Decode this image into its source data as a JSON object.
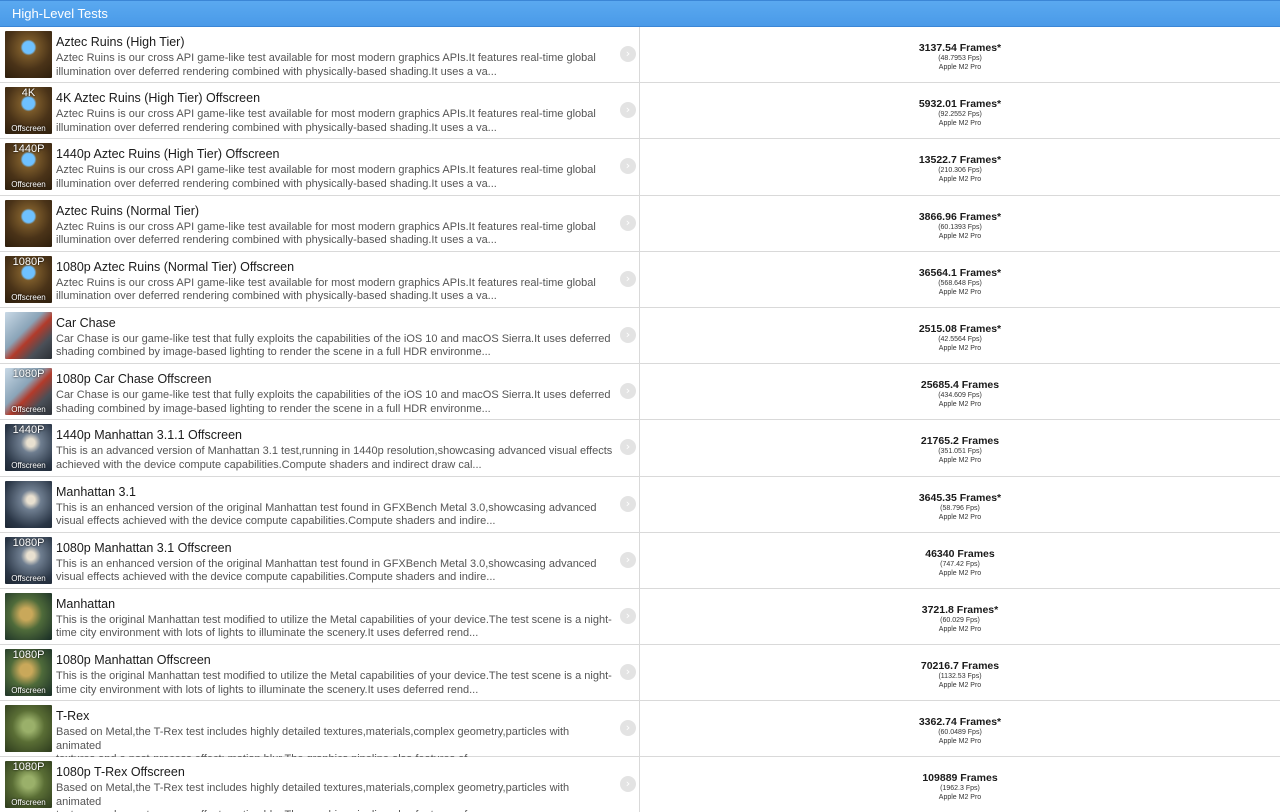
{
  "header": {
    "title": "High-Level Tests"
  },
  "tests": [
    {
      "thumb": "aztec",
      "thumb_top": "",
      "thumb_bottom": "",
      "title": "Aztec Ruins (High Tier)",
      "desc_line1": "Aztec Ruins is our cross API game-like test available for most modern graphics APIs.It features real-time global",
      "desc_line2": "illumination over deferred rendering combined with physically-based shading.It uses a va...",
      "score": "3137.54 Frames*",
      "fps": "(48.7953 Fps)",
      "device": "Apple M2 Pro"
    },
    {
      "thumb": "aztec",
      "thumb_top": "4K",
      "thumb_bottom": "Offscreen",
      "title": "4K Aztec Ruins (High Tier) Offscreen",
      "desc_line1": "Aztec Ruins is our cross API game-like test available for most modern graphics APIs.It features real-time global",
      "desc_line2": "illumination over deferred rendering combined with physically-based shading.It uses a va...",
      "score": "5932.01 Frames*",
      "fps": "(92.2552 Fps)",
      "device": "Apple M2 Pro"
    },
    {
      "thumb": "aztec",
      "thumb_top": "1440P",
      "thumb_bottom": "Offscreen",
      "title": "1440p Aztec Ruins (High Tier) Offscreen",
      "desc_line1": "Aztec Ruins is our cross API game-like test available for most modern graphics APIs.It features real-time global",
      "desc_line2": "illumination over deferred rendering combined with physically-based shading.It uses a va...",
      "score": "13522.7 Frames*",
      "fps": "(210.306 Fps)",
      "device": "Apple M2 Pro"
    },
    {
      "thumb": "aztec",
      "thumb_top": "",
      "thumb_bottom": "",
      "title": "Aztec Ruins (Normal Tier)",
      "desc_line1": "Aztec Ruins is our cross API game-like test available for most modern graphics APIs.It features real-time global",
      "desc_line2": "illumination over deferred rendering combined with physically-based shading.It uses a va...",
      "score": "3866.96 Frames*",
      "fps": "(60.1393 Fps)",
      "device": "Apple M2 Pro"
    },
    {
      "thumb": "aztec",
      "thumb_top": "1080P",
      "thumb_bottom": "Offscreen",
      "title": "1080p Aztec Ruins (Normal Tier) Offscreen",
      "desc_line1": "Aztec Ruins is our cross API game-like test available for most modern graphics APIs.It features real-time global",
      "desc_line2": "illumination over deferred rendering combined with physically-based shading.It uses a va...",
      "score": "36564.1 Frames*",
      "fps": "(568.648 Fps)",
      "device": "Apple M2 Pro"
    },
    {
      "thumb": "car",
      "thumb_top": "",
      "thumb_bottom": "",
      "title": "Car Chase",
      "desc_line1": "Car Chase is our game-like test that fully exploits the capabilities of the iOS 10 and macOS Sierra.It uses deferred",
      "desc_line2": "shading combined by image-based lighting to render the scene in a full HDR environme...",
      "score": "2515.08 Frames*",
      "fps": "(42.5564 Fps)",
      "device": "Apple M2 Pro"
    },
    {
      "thumb": "car",
      "thumb_top": "1080P",
      "thumb_bottom": "Offscreen",
      "title": "1080p Car Chase Offscreen",
      "desc_line1": "Car Chase is our game-like test that fully exploits the capabilities of the iOS 10 and macOS Sierra.It uses deferred",
      "desc_line2": "shading combined by image-based lighting to render the scene in a full HDR environme...",
      "score": "25685.4 Frames",
      "fps": "(434.609 Fps)",
      "device": "Apple M2 Pro"
    },
    {
      "thumb": "man",
      "thumb_top": "1440P",
      "thumb_bottom": "Offscreen",
      "title": "1440p Manhattan 3.1.1 Offscreen",
      "desc_line1": "This is an advanced version of Manhattan 3.1 test,running in 1440p resolution,showcasing advanced visual effects",
      "desc_line2": "achieved with the device compute capabilities.Compute shaders and indirect draw cal...",
      "score": "21765.2 Frames",
      "fps": "(351.051 Fps)",
      "device": "Apple M2 Pro"
    },
    {
      "thumb": "man",
      "thumb_top": "",
      "thumb_bottom": "",
      "title": "Manhattan 3.1",
      "desc_line1": "This is an enhanced version of the original Manhattan test found in GFXBench Metal 3.0,showcasing advanced",
      "desc_line2": "visual effects achieved with the device compute capabilities.Compute shaders and indire...",
      "score": "3645.35 Frames*",
      "fps": "(58.796 Fps)",
      "device": "Apple M2 Pro"
    },
    {
      "thumb": "man",
      "thumb_top": "1080P",
      "thumb_bottom": "Offscreen",
      "title": "1080p Manhattan 3.1 Offscreen",
      "desc_line1": "This is an enhanced version of the original Manhattan test found in GFXBench Metal 3.0,showcasing advanced",
      "desc_line2": "visual effects achieved with the device compute capabilities.Compute shaders and indire...",
      "score": "46340 Frames",
      "fps": "(747.42 Fps)",
      "device": "Apple M2 Pro"
    },
    {
      "thumb": "man2",
      "thumb_top": "",
      "thumb_bottom": "",
      "title": "Manhattan",
      "desc_line1": "This is the original Manhattan test modified to utilize the Metal capabilities of your device.The test scene is a night-",
      "desc_line2": "time city environment with lots of lights to illuminate the scenery.It uses deferred rend...",
      "score": "3721.8 Frames*",
      "fps": "(60.029 Fps)",
      "device": "Apple M2 Pro"
    },
    {
      "thumb": "man2",
      "thumb_top": "1080P",
      "thumb_bottom": "Offscreen",
      "title": "1080p Manhattan Offscreen",
      "desc_line1": "This is the original Manhattan test modified to utilize the Metal capabilities of your device.The test scene is a night-",
      "desc_line2": "time city environment with lots of lights to illuminate the scenery.It uses deferred rend...",
      "score": "70216.7 Frames",
      "fps": "(1132.53 Fps)",
      "device": "Apple M2 Pro"
    },
    {
      "thumb": "trex",
      "thumb_top": "",
      "thumb_bottom": "",
      "title": "T-Rex",
      "desc_line1": "Based on Metal,the T-Rex test includes highly detailed textures,materials,complex geometry,particles with animated",
      "desc_line2": "textures and a post-process effect: motion blur.The graphics pipeline also features ef...",
      "score": "3362.74 Frames*",
      "fps": "(60.0489 Fps)",
      "device": "Apple M2 Pro"
    },
    {
      "thumb": "trex",
      "thumb_top": "1080P",
      "thumb_bottom": "Offscreen",
      "title": "1080p T-Rex Offscreen",
      "desc_line1": "Based on Metal,the T-Rex test includes highly detailed textures,materials,complex geometry,particles with animated",
      "desc_line2": "textures and a post-process effect: motion blur.The graphics pipeline also features ef...",
      "score": "109889 Frames",
      "fps": "(1962.3 Fps)",
      "device": "Apple M2 Pro"
    }
  ]
}
